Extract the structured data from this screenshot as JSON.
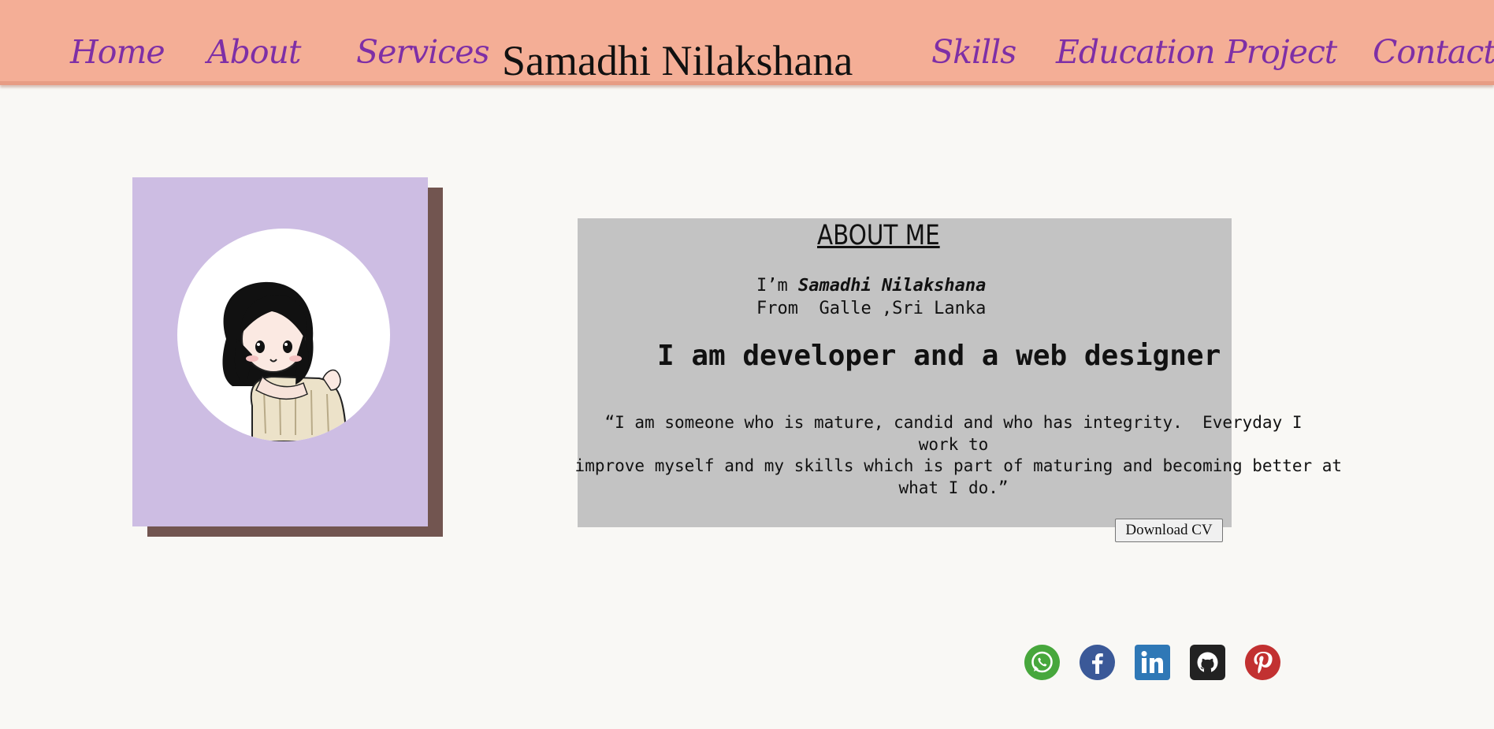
{
  "nav": {
    "brand": "Samadhi Nilakshana",
    "items": [
      {
        "label": "Home"
      },
      {
        "label": "About"
      },
      {
        "label": "Services"
      },
      {
        "label": "Skills"
      },
      {
        "label": "Education"
      },
      {
        "label": "Project"
      },
      {
        "label": "Contact"
      }
    ]
  },
  "about": {
    "title": "ABOUT ME",
    "greeting_prefix": "I’m ",
    "name": "Samadhi Nilakshana",
    "from": "From  Galle ,Sri Lanka",
    "headline": "I am developer and a web designer",
    "quote_lines": [
      "“I am someone who is mature, candid and who has integrity.  Everyday I",
      "work to",
      " improve myself and my skills which is part of maturing and becoming better at",
      "what I do.”"
    ],
    "download_label": "Download CV"
  },
  "social": [
    {
      "name": "whatsapp",
      "color": "#47a73c"
    },
    {
      "name": "facebook",
      "color": "#3b5998"
    },
    {
      "name": "linkedin",
      "color": "#2f78b6"
    },
    {
      "name": "github",
      "color": "#222222"
    },
    {
      "name": "pinterest",
      "color": "#c23131"
    }
  ],
  "colors": {
    "nav_bg": "#f4ae96",
    "nav_link": "#7e2fa6",
    "page_bg": "#f9f8f5",
    "card_bg": "#c3c3c3",
    "photo_bg": "#cdbde3",
    "photo_shadow": "#725550"
  }
}
